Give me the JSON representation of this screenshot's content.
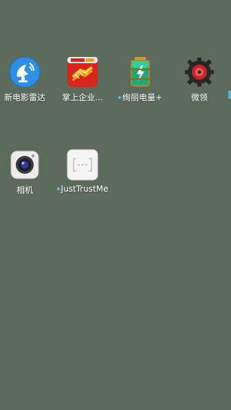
{
  "home": {
    "apps": [
      {
        "label": "新电影雷达",
        "icon": "radar-dish-icon"
      },
      {
        "label": "掌上企业...",
        "icon": "handshake-icon"
      },
      {
        "label": "绚丽电量+",
        "icon": "battery-icon"
      },
      {
        "label": "微领",
        "icon": "gear-badge-icon"
      },
      {
        "label": "相机",
        "icon": "camera-icon"
      },
      {
        "label": "JustTrustMe",
        "icon": "placeholder-app-icon"
      }
    ]
  },
  "colors": {
    "wallpaper": "#5c6b5c",
    "label": "#ffffff",
    "new_install_dot": "#4fc3f7"
  }
}
